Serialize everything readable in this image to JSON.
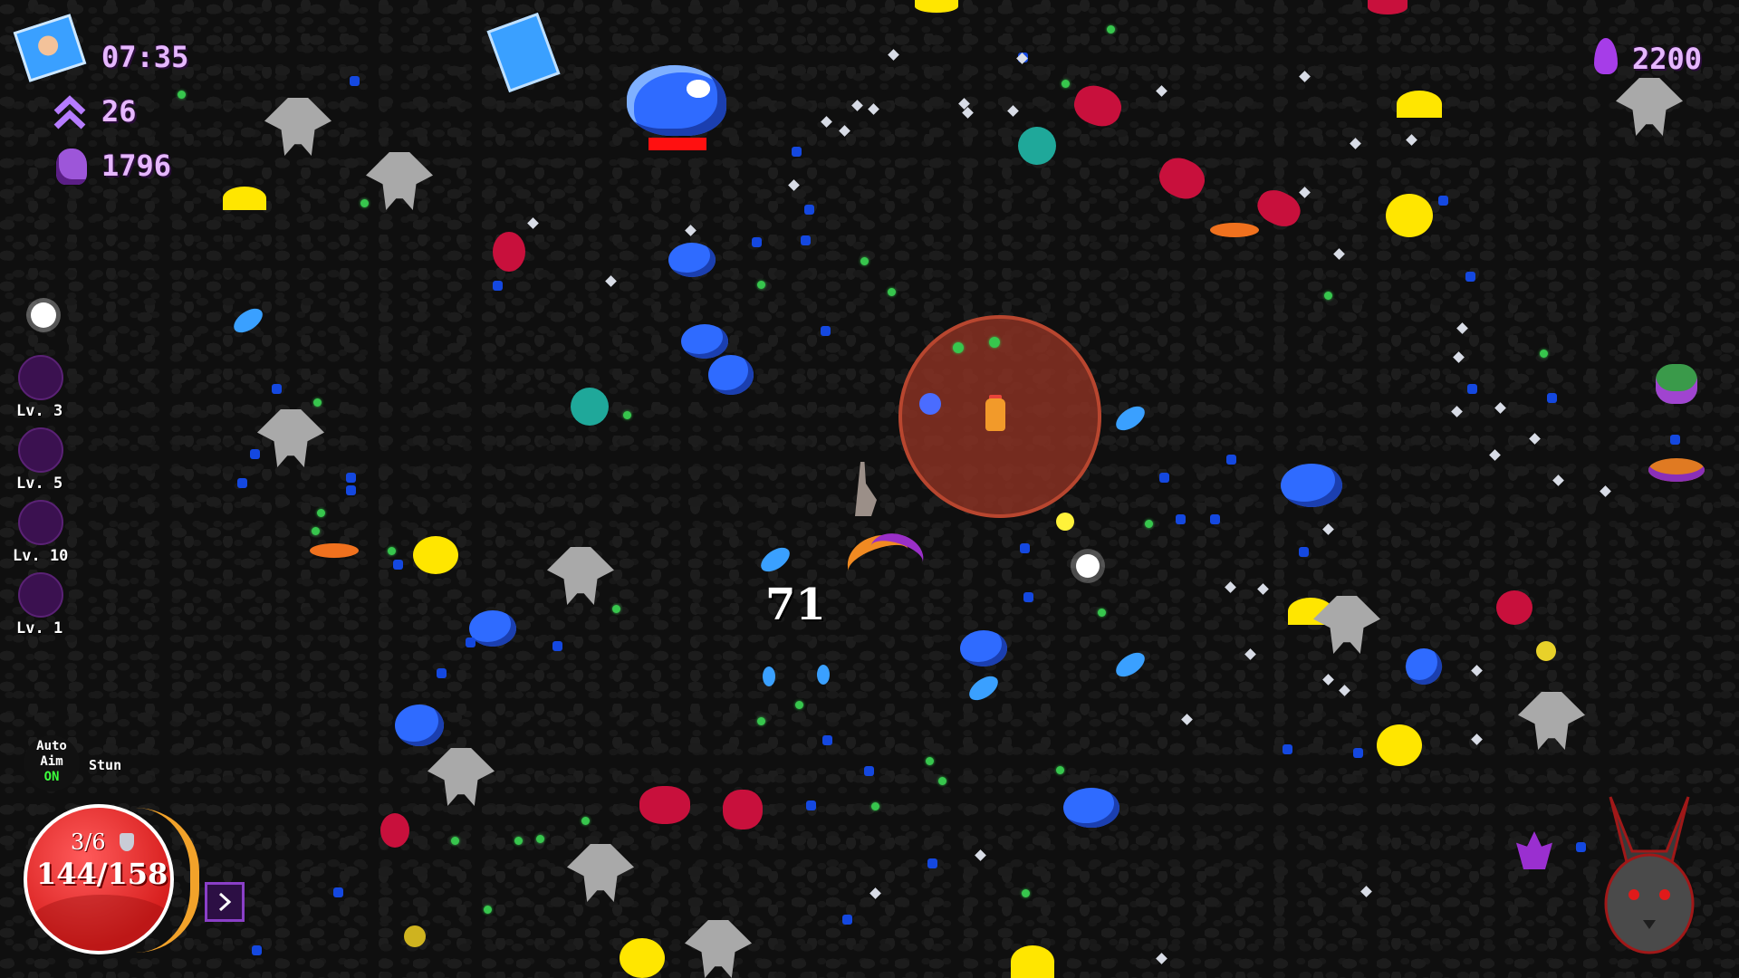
{
  "hud": {
    "timer": "07:35",
    "level": "26",
    "kills": "1796",
    "currency": "2200"
  },
  "skills": [
    {
      "label": "Lv. 3"
    },
    {
      "label": "Lv. 5"
    },
    {
      "label": "Lv. 10"
    },
    {
      "label": "Lv. 1"
    }
  ],
  "controls": {
    "auto_aim_line1": "Auto",
    "auto_aim_line2": "Aim",
    "auto_aim_state": "ON",
    "stun_label": "Stun"
  },
  "health": {
    "charges": "3/6",
    "hp": "144/158",
    "hp_value": 144,
    "hp_max": 158
  },
  "damage_popup": "71",
  "colors": {
    "hud_purple": "#e6b7ff",
    "aura_red": "#a03c2c",
    "enemy_blue": "#2f6bff",
    "enemy_yellow": "#ffe600",
    "enemy_red": "#c8103c",
    "enemy_grey": "#a9a9a9",
    "on_green": "#3cff3c"
  },
  "icons": {
    "timer": "paw-shield-icon",
    "level": "double-chevron-up-icon",
    "kills": "skull-icon",
    "currency": "purple-flame-icon",
    "skill1": "sun-icon",
    "next": "chevron-right-icon",
    "portrait": "rabbit-head-icon"
  }
}
